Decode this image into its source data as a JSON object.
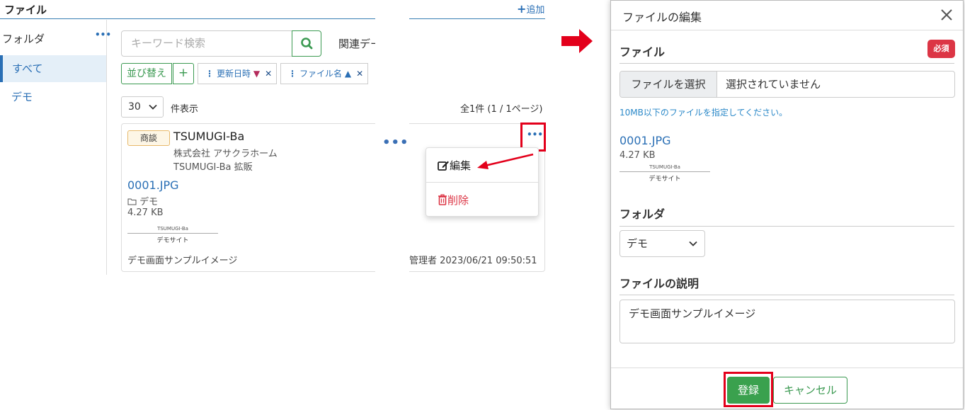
{
  "left": {
    "page_title": "ファイル",
    "add_label": "追加",
    "folder_pane": {
      "heading": "フォルダ",
      "items": [
        {
          "label": "すべて",
          "active": true
        },
        {
          "label": "デモ",
          "active": false
        }
      ]
    },
    "search": {
      "placeholder": "キーワード検索",
      "related_label": "関連データ"
    },
    "sort": {
      "sort_label": "並び替え",
      "add_label": "+",
      "chips": [
        {
          "label": "更新日時",
          "direction": "▼"
        },
        {
          "label": "ファイル名",
          "direction": "▲"
        }
      ]
    },
    "pagination": {
      "per_page": "30",
      "per_page_label": "件表示",
      "total": "全1件 (1 / 1ページ)"
    },
    "card": {
      "tag": "商談",
      "title": "TSUMUGI-Ba",
      "company": "株式会社 アサクラホーム",
      "deal": "TSUMUGI-Ba 拡販",
      "file_name": "0001.JPG",
      "folder": "デモ",
      "size": "4.27 KB",
      "thumb_logo": "TSUMUGI-Ba",
      "thumb_site": "デモサイト",
      "description": "デモ画面サンプルイメージ",
      "meta": "管理者 2023/06/21 09:50:51"
    },
    "context_menu": {
      "edit": "編集",
      "delete": "削除"
    }
  },
  "modal": {
    "title": "ファイルの編集",
    "file_section": "ファイル",
    "required_badge": "必須",
    "file_button": "ファイルを選択",
    "file_status": "選択されていません",
    "help_text": "10MB以下のファイルを指定してください。",
    "file_name": "0001.JPG",
    "size": "4.27 KB",
    "thumb_logo": "TSUMUGI-Ba",
    "thumb_site": "デモサイト",
    "folder_section": "フォルダ",
    "folder_value": "デモ",
    "desc_section": "ファイルの説明",
    "desc_value": "デモ画面サンプルイメージ",
    "save_label": "登録",
    "cancel_label": "キャンセル"
  },
  "colors": {
    "accent_blue": "#2a6fb5",
    "accent_green": "#3c9a52",
    "danger_red": "#dc3545",
    "highlight_red": "#e3001b"
  }
}
